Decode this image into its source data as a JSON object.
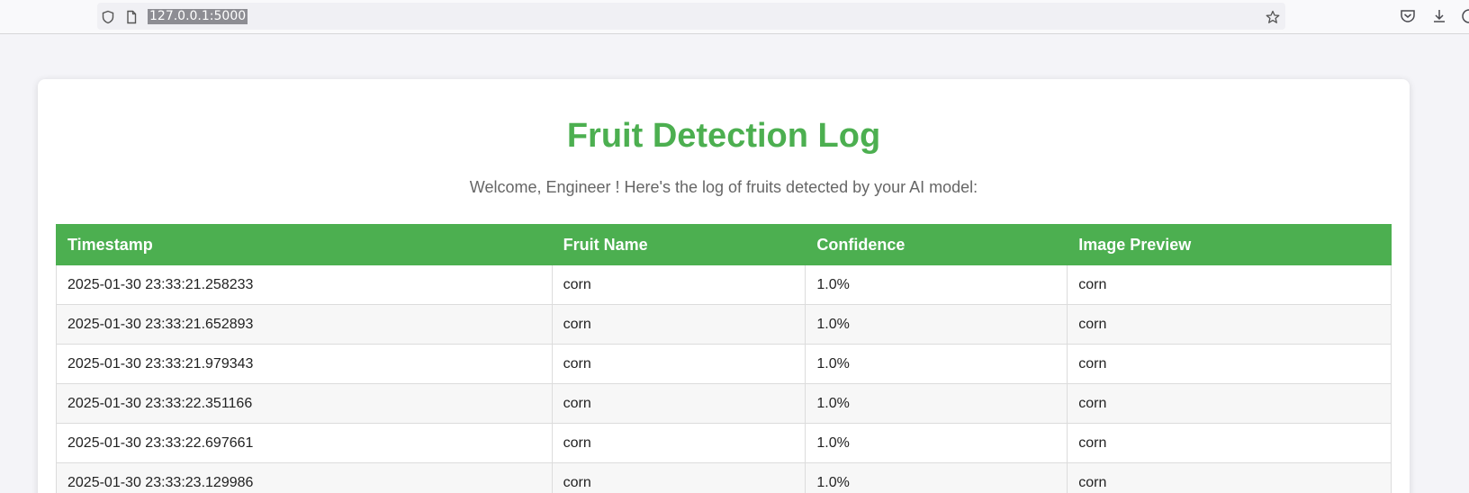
{
  "browser": {
    "url": "127.0.0.1:5000"
  },
  "page": {
    "title": "Fruit Detection Log",
    "subtitle": "Welcome, Engineer ! Here's the log of fruits detected by your AI model:"
  },
  "table": {
    "headers": [
      "Timestamp",
      "Fruit Name",
      "Confidence",
      "Image Preview"
    ],
    "rows": [
      [
        "2025-01-30 23:33:21.258233",
        "corn",
        "1.0%",
        "corn"
      ],
      [
        "2025-01-30 23:33:21.652893",
        "corn",
        "1.0%",
        "corn"
      ],
      [
        "2025-01-30 23:33:21.979343",
        "corn",
        "1.0%",
        "corn"
      ],
      [
        "2025-01-30 23:33:22.351166",
        "corn",
        "1.0%",
        "corn"
      ],
      [
        "2025-01-30 23:33:22.697661",
        "corn",
        "1.0%",
        "corn"
      ],
      [
        "2025-01-30 23:33:23.129986",
        "corn",
        "1.0%",
        "corn"
      ]
    ]
  },
  "colors": {
    "accent": "#4caf50",
    "background": "#f4f4f8"
  }
}
